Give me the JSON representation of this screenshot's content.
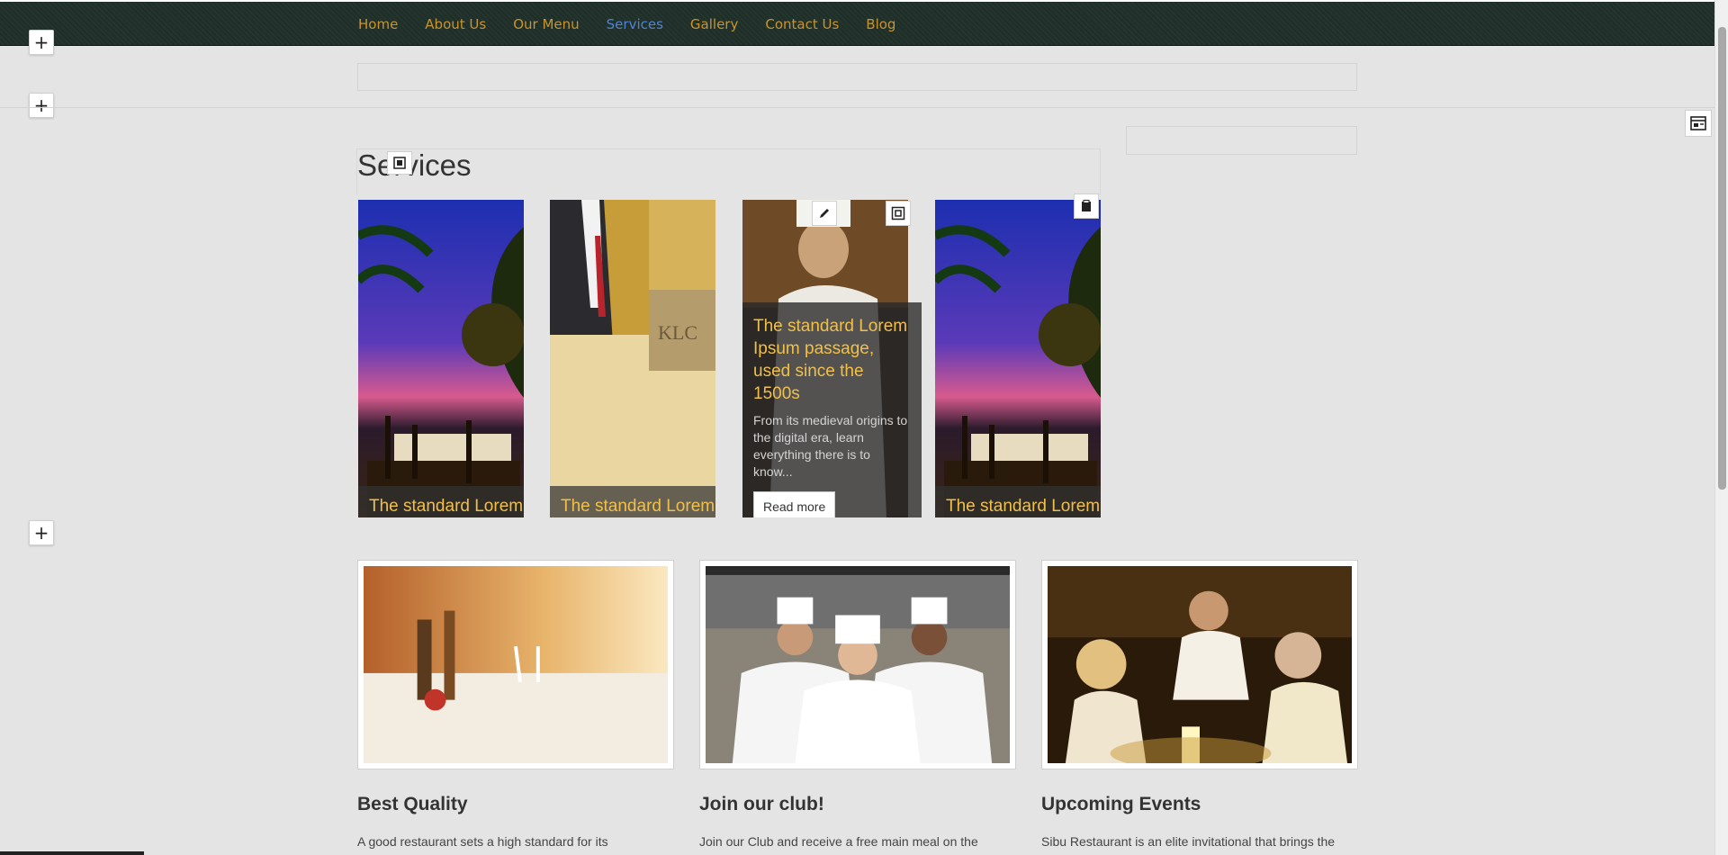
{
  "nav": {
    "items": [
      {
        "label": "Home",
        "active": false
      },
      {
        "label": "About Us",
        "active": false
      },
      {
        "label": "Our Menu",
        "active": false
      },
      {
        "label": "Services",
        "active": true
      },
      {
        "label": "Gallery",
        "active": false
      },
      {
        "label": "Contact Us",
        "active": false
      },
      {
        "label": "Blog",
        "active": false
      }
    ],
    "text_color": "#c8942f",
    "active_color": "#4f84d6"
  },
  "editor": {
    "add_label": "+"
  },
  "services": {
    "title": "Services",
    "cards": [
      {
        "caption": "The standard Lorem",
        "image": "beach-restaurant-sunset-image"
      },
      {
        "caption": "The standard Lorem",
        "image": "reception-desk-image"
      },
      {
        "title": "The standard Lorem Ipsum passage, used since the 1500s",
        "text": "From its medieval origins to the digital era, learn everything there is to know...",
        "read_more": "Read more",
        "image": "chef-smiling-image"
      },
      {
        "caption": "The standard Lorem",
        "image": "beach-restaurant-sunset-image"
      }
    ]
  },
  "features": [
    {
      "title": "Best Quality",
      "text": "A good restaurant sets a high standard for its",
      "image": "table-setting-image"
    },
    {
      "title": "Join our club!",
      "text": "Join our Club and receive a free main meal on the",
      "image": "three-chefs-image"
    },
    {
      "title": "Upcoming Events",
      "text": "Sibu Restaurant is an elite invitational that brings the",
      "image": "dinner-guests-image"
    }
  ]
}
